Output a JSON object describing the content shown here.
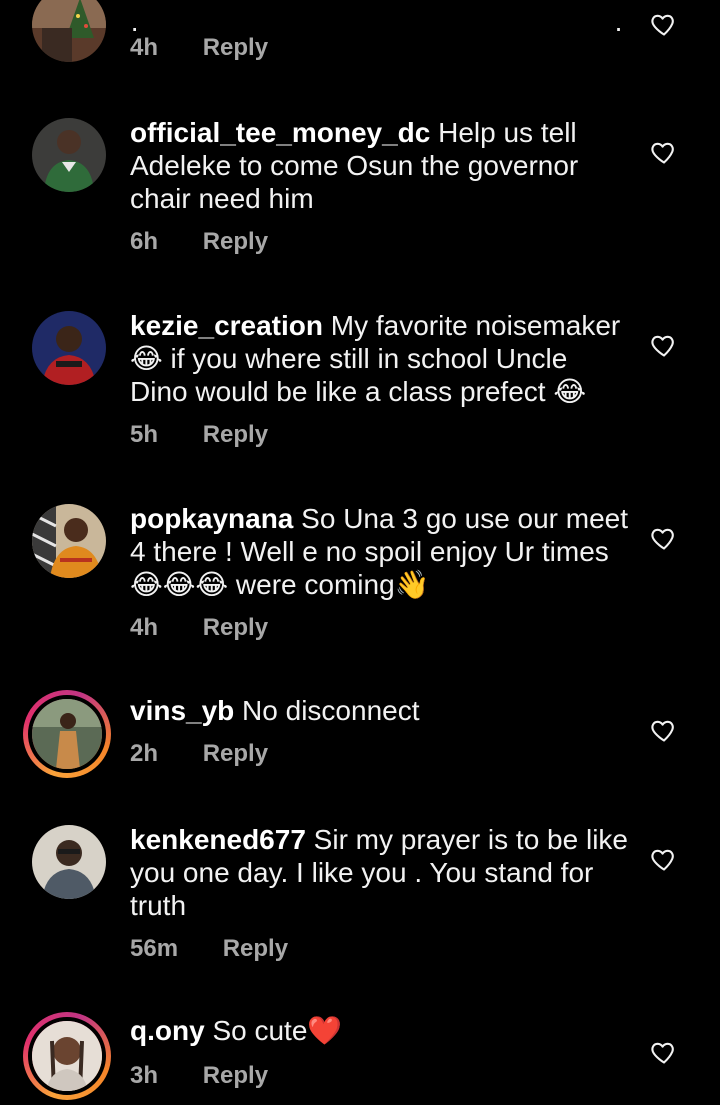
{
  "comments": [
    {
      "username": "",
      "text": "",
      "time": "4h",
      "reply": "Reply"
    },
    {
      "username": "official_tee_money_dc",
      "text_line1": " Help us tell",
      "text_line2": "Adeleke to come Osun the governor",
      "text_line3": "chair need him",
      "time": "6h",
      "reply": "Reply"
    },
    {
      "username": "kezie_creation",
      "text_line1": " My favorite noisemaker",
      "text_line2": " if you where still in school Uncle",
      "text_line3": "Dino would be like a class prefect ",
      "emoji": "😂",
      "time": "5h",
      "reply": "Reply"
    },
    {
      "username": "popkaynana",
      "text_line1": " So Una 3 go use our meet",
      "text_line2": "4 there ! Well e no spoil enjoy Ur times",
      "text_line3": " were coming",
      "emojis": "😂😂😂",
      "wave": "👋",
      "time": "4h",
      "reply": "Reply"
    },
    {
      "username": "vins_yb",
      "text": " No disconnect",
      "time": "2h",
      "reply": "Reply"
    },
    {
      "username": "kenkened677",
      "text_line1": " Sir my prayer is to be like",
      "text_line2": "you one day. I like you . You stand for",
      "text_line3": "truth",
      "time": "56m",
      "reply": "Reply"
    },
    {
      "username": "q.ony",
      "text": " So cute",
      "heart_emoji": "❤️",
      "time": "3h",
      "reply": "Reply"
    }
  ],
  "icons": {
    "like": "heart-outline-icon"
  },
  "colors": {
    "background": "#000000",
    "text": "#f2f2f2",
    "meta": "#a8a8a8"
  }
}
